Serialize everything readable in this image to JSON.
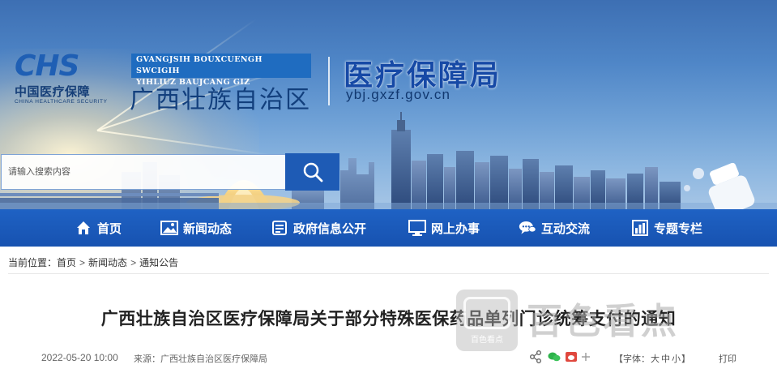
{
  "header": {
    "logo_mark": "CHS",
    "logo_cn": "中国医疗保障",
    "logo_en": "CHINA HEALTHCARE SECURITY",
    "zhuang_line1": "GVANGJSIH BOUXCUENGH SWCIGIH",
    "zhuang_line2": "YIHLIUZ BAUJCANG GIZ",
    "region_name": "广西壮族自治区",
    "bureau_name": "医疗保障局",
    "domain": "ybj.gxzf.gov.cn"
  },
  "search": {
    "placeholder": "请输入搜索内容",
    "button_icon": "search-icon"
  },
  "nav": {
    "items": [
      {
        "label": "首页",
        "icon": "home-icon"
      },
      {
        "label": "新闻动态",
        "icon": "image-icon"
      },
      {
        "label": "政府信息公开",
        "icon": "document-icon"
      },
      {
        "label": "网上办事",
        "icon": "monitor-icon"
      },
      {
        "label": "互动交流",
        "icon": "chat-icon"
      },
      {
        "label": "专题专栏",
        "icon": "bar-chart-icon"
      }
    ]
  },
  "breadcrumb": {
    "prefix": "当前位置：",
    "items": [
      "首页",
      "新闻动态",
      "通知公告"
    ],
    "separator": ">"
  },
  "article": {
    "title": "广西壮族自治区医疗保障局关于部分特殊医保药品单列门诊统筹支付的通知",
    "date": "2022-05-20 10:00",
    "source": "来源：广西壮族自治区医疗保障局",
    "font_size_prefix": "【字体：",
    "font_size_options": [
      "大",
      "中",
      "小"
    ],
    "font_size_suffix": "】",
    "print_label": "打印"
  },
  "watermark": {
    "small_label": "百色看点",
    "text": "百色看点"
  },
  "colors": {
    "nav_blue": "#1a58b8",
    "brand_blue": "#1f5fb4",
    "title_text": "#222222"
  }
}
